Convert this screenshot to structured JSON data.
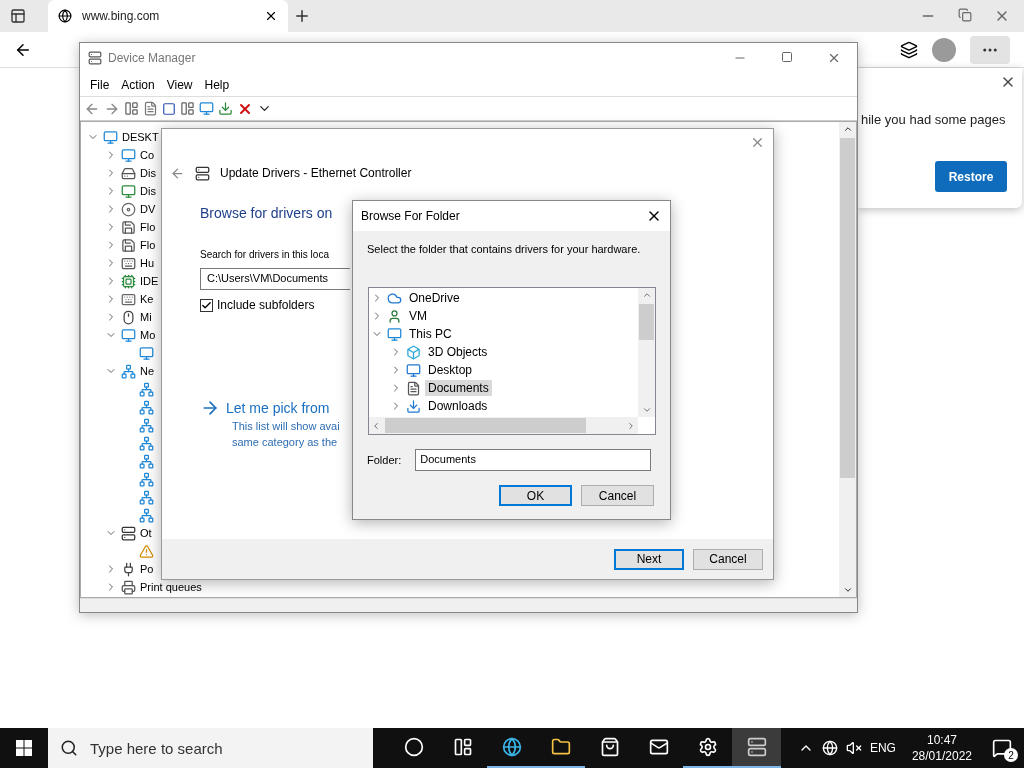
{
  "browser": {
    "tab": {
      "title": "www.bing.com"
    },
    "popup": {
      "message": "hile you had some pages",
      "button": "Restore"
    }
  },
  "device_manager": {
    "title": "Device Manager",
    "menu": [
      "File",
      "Action",
      "View",
      "Help"
    ],
    "tree": [
      {
        "label": "DESKT",
        "kind": "computer",
        "expanded": true,
        "children": [
          {
            "label": "Co",
            "kind": "computer",
            "expanded": false
          },
          {
            "label": "Dis",
            "kind": "disk",
            "expanded": false
          },
          {
            "label": "Dis",
            "kind": "display",
            "expanded": false
          },
          {
            "label": "DV",
            "kind": "dvd",
            "expanded": false
          },
          {
            "label": "Flo",
            "kind": "floppy",
            "expanded": false
          },
          {
            "label": "Flo",
            "kind": "floppy",
            "expanded": false
          },
          {
            "label": "Hu",
            "kind": "hid",
            "expanded": false
          },
          {
            "label": "IDE",
            "kind": "ide",
            "expanded": false
          },
          {
            "label": "Ke",
            "kind": "keyboard",
            "expanded": false
          },
          {
            "label": "Mi",
            "kind": "mouse",
            "expanded": false
          },
          {
            "label": "Mo",
            "kind": "monitor",
            "expanded": true,
            "children": [
              {
                "kind": "monitor"
              }
            ]
          },
          {
            "label": "Ne",
            "kind": "network",
            "expanded": true,
            "children": [
              {
                "kind": "network"
              },
              {
                "kind": "network"
              },
              {
                "kind": "network"
              },
              {
                "kind": "network"
              },
              {
                "kind": "network"
              },
              {
                "kind": "network"
              },
              {
                "kind": "network"
              },
              {
                "kind": "network"
              }
            ]
          },
          {
            "label": "Ot",
            "kind": "other",
            "expanded": true,
            "children": [
              {
                "kind": "warning"
              }
            ]
          },
          {
            "label": "Po",
            "kind": "port",
            "expanded": false
          },
          {
            "label": "Print queues",
            "kind": "printer",
            "expanded": false
          }
        ]
      }
    ]
  },
  "update_drivers": {
    "title": "Update Drivers - Ethernet Controller",
    "heading": "Browse for drivers on",
    "search_label": "Search for drivers in this loca",
    "path": "C:\\Users\\VM\\Documents",
    "include_subfolders": {
      "label": "Include subfolders",
      "checked": true
    },
    "pick_link": "Let me pick from",
    "pick_description": [
      "This list will show avai",
      "same category as the"
    ],
    "buttons": [
      {
        "label": "Next",
        "default": true
      },
      {
        "label": "Cancel",
        "default": false
      }
    ]
  },
  "browse_folder": {
    "title": "Browse For Folder",
    "instruction": "Select the folder that contains drivers for your hardware.",
    "tree": [
      {
        "label": "OneDrive",
        "kind": "cloud",
        "expanded": false,
        "selected": false
      },
      {
        "label": "VM",
        "kind": "user",
        "expanded": false,
        "selected": false
      },
      {
        "label": "This PC",
        "kind": "pc",
        "expanded": true,
        "selected": false,
        "children": [
          {
            "label": "3D Objects",
            "kind": "objects",
            "expanded": false,
            "selected": false
          },
          {
            "label": "Desktop",
            "kind": "desktop",
            "expanded": false,
            "selected": false
          },
          {
            "label": "Documents",
            "kind": "documents",
            "expanded": false,
            "selected": true
          },
          {
            "label": "Downloads",
            "kind": "downloads",
            "expanded": false,
            "selected": false
          }
        ]
      }
    ],
    "folder_label": "Folder:",
    "folder_value": "Documents",
    "buttons": [
      {
        "label": "OK",
        "default": true
      },
      {
        "label": "Cancel",
        "default": false
      }
    ]
  },
  "taskbar": {
    "search_placeholder": "Type here to search",
    "apps": [
      {
        "kind": "cortana",
        "open": false,
        "selected": false
      },
      {
        "kind": "taskview",
        "open": false,
        "selected": false
      },
      {
        "kind": "edge",
        "open": true,
        "selected": false
      },
      {
        "kind": "explorer",
        "open": true,
        "selected": false
      },
      {
        "kind": "store",
        "open": false,
        "selected": false
      },
      {
        "kind": "mail",
        "open": false,
        "selected": false
      },
      {
        "kind": "settings",
        "open": true,
        "selected": false
      },
      {
        "kind": "devmgr",
        "open": true,
        "selected": true
      }
    ],
    "language": "ENG",
    "time": "10:47",
    "date": "28/01/2022",
    "notifications": "2"
  }
}
